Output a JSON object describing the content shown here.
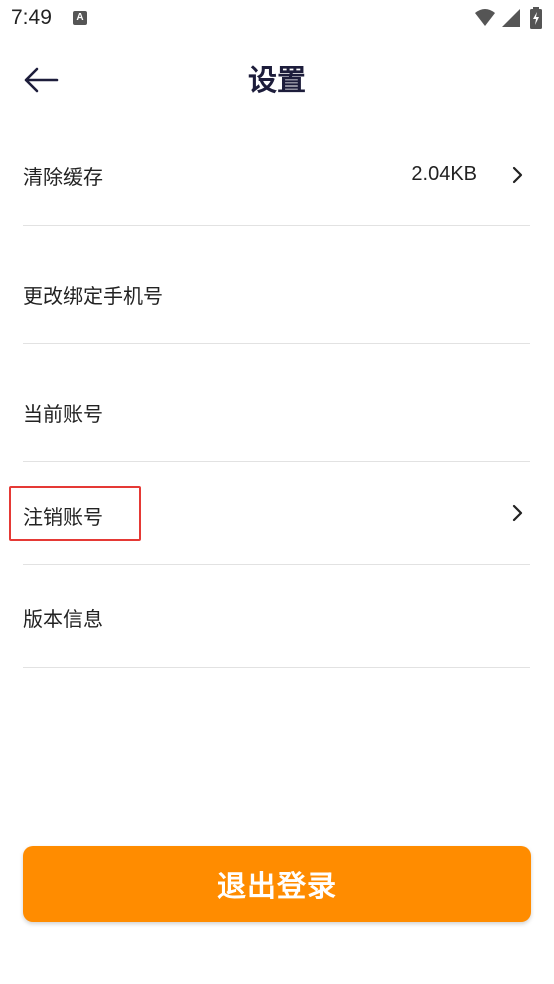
{
  "status_bar": {
    "time": "7:49",
    "notification_icon": "a-notification-icon",
    "wifi_icon": "wifi-icon",
    "signal_icon": "signal-icon",
    "battery_icon": "battery-charging-icon"
  },
  "header": {
    "back_icon": "arrow-left-icon",
    "title": "设置"
  },
  "settings": {
    "items": [
      {
        "label": "清除缓存",
        "value": "2.04KB",
        "has_chevron": true
      },
      {
        "label": "更改绑定手机号",
        "value": "",
        "has_chevron": false
      },
      {
        "label": "当前账号",
        "value": "",
        "has_chevron": false
      },
      {
        "label": "注销账号",
        "value": "",
        "has_chevron": true,
        "highlighted": true
      },
      {
        "label": "版本信息",
        "value": "",
        "has_chevron": false
      }
    ]
  },
  "footer": {
    "logout_label": "退出登录"
  },
  "colors": {
    "accent": "#ff8c00",
    "title": "#1d1d3b",
    "highlight_border": "#e53935",
    "divider": "#e2e2e2"
  }
}
